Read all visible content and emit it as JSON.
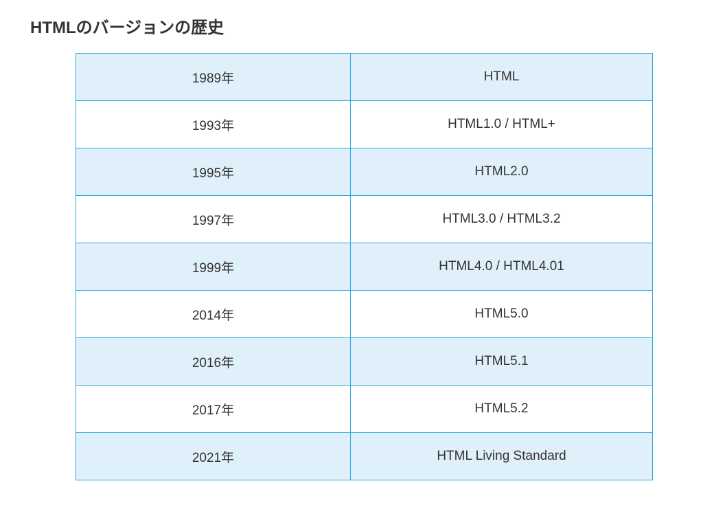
{
  "title": "HTMLのバージョンの歴史",
  "chart_data": {
    "type": "table",
    "columns": [
      "year",
      "version"
    ],
    "rows": [
      {
        "year": "1989年",
        "version": "HTML"
      },
      {
        "year": "1993年",
        "version": "HTML1.0 / HTML+"
      },
      {
        "year": "1995年",
        "version": "HTML2.0"
      },
      {
        "year": "1997年",
        "version": "HTML3.0 / HTML3.2"
      },
      {
        "year": "1999年",
        "version": "HTML4.0 / HTML4.01"
      },
      {
        "year": "2014年",
        "version": "HTML5.0"
      },
      {
        "year": "2016年",
        "version": "HTML5.1"
      },
      {
        "year": "2017年",
        "version": "HTML5.2"
      },
      {
        "year": "2021年",
        "version": "HTML Living Standard"
      }
    ]
  }
}
